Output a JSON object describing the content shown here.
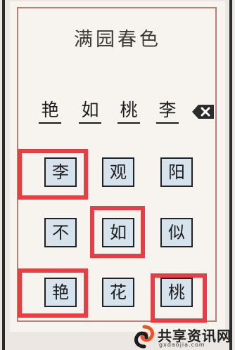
{
  "puzzle": {
    "title": "满园春色",
    "answer_slots": [
      "艳",
      "如",
      "桃",
      "李"
    ]
  },
  "grid": {
    "tiles": [
      {
        "char": "李",
        "highlighted": true
      },
      {
        "char": "观",
        "highlighted": false
      },
      {
        "char": "阳",
        "highlighted": false
      },
      {
        "char": "不",
        "highlighted": false
      },
      {
        "char": "如",
        "highlighted": true
      },
      {
        "char": "似",
        "highlighted": false
      },
      {
        "char": "艳",
        "highlighted": true
      },
      {
        "char": "花",
        "highlighted": false
      },
      {
        "char": "桃",
        "highlighted": true
      }
    ]
  },
  "icons": {
    "backspace": "backspace-icon",
    "watermark_logo": "logo-icon"
  },
  "watermark": {
    "name": "共享资讯网",
    "domain": "gxdaojia.com"
  },
  "colors": {
    "tile_fill": "#d6e2ec",
    "highlight": "#e93d44",
    "frame": "#b87f77"
  }
}
